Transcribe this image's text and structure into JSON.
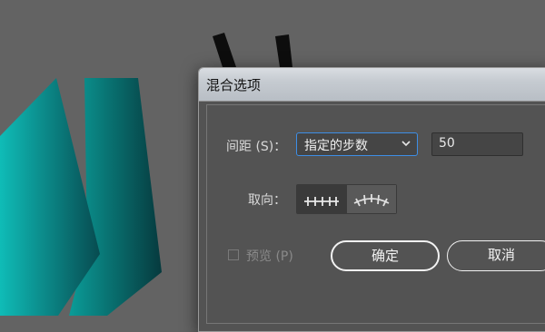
{
  "dialog": {
    "title": "混合选项",
    "spacing_label": "间距 (S)：",
    "spacing_select_value": "指定的步数",
    "spacing_number_value": "50",
    "orientation_label": "取向：",
    "preview_label": "预览 (P)",
    "preview_checked": false,
    "ok_label": "确定",
    "cancel_label": "取消"
  },
  "colors": {
    "canvas": "#636363",
    "teal_light": "#0fb5b0",
    "teal_dark": "#0a4d52",
    "focus_ring": "#3d8ee6"
  },
  "icons": {
    "orient_align_page": "orient-align-page-icon",
    "orient_align_path": "orient-align-path-icon",
    "dropdown": "chevron-down-icon"
  }
}
